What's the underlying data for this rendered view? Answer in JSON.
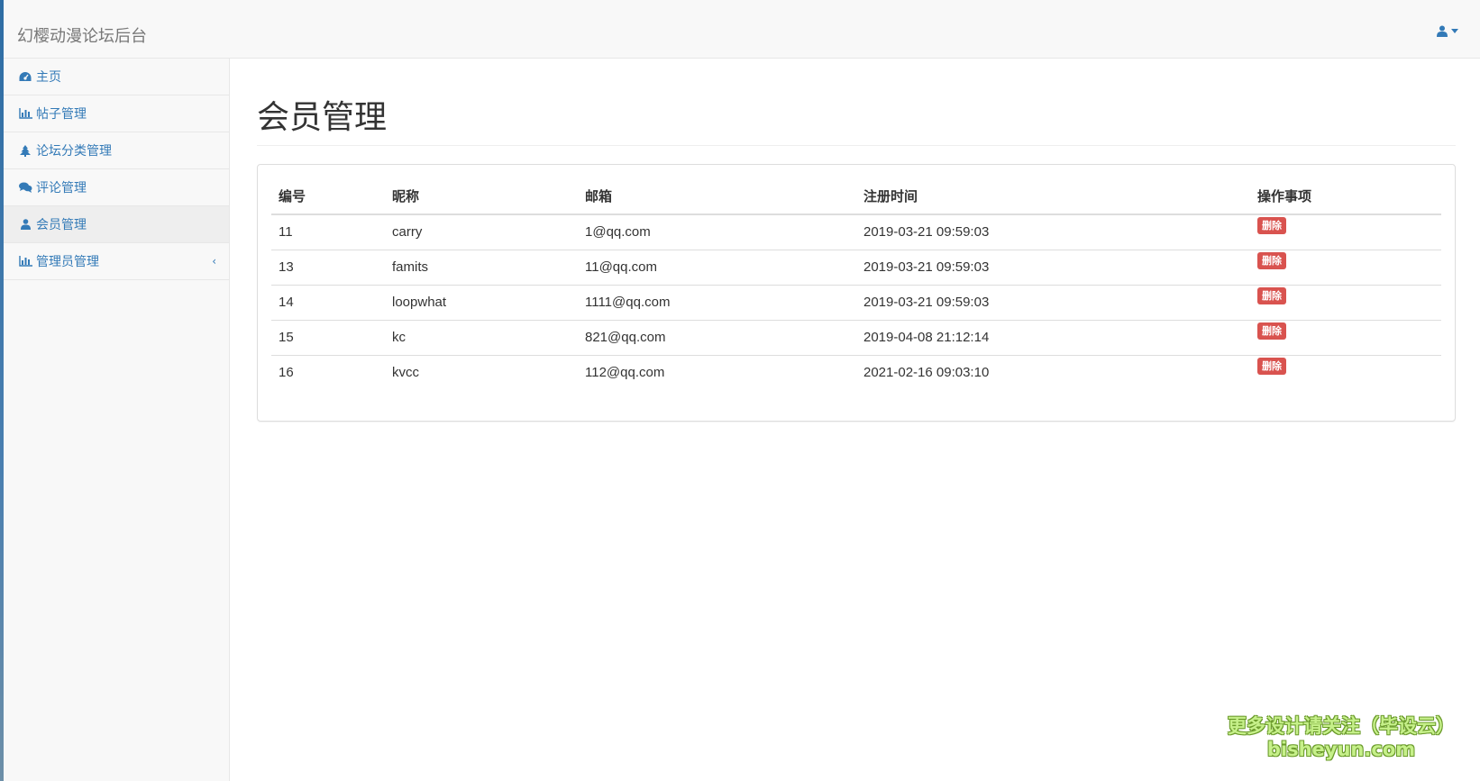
{
  "navbar": {
    "brand": "幻樱动漫论坛后台",
    "user_icon": "user-icon",
    "caret_icon": "caret-down-icon"
  },
  "sidebar": {
    "items": [
      {
        "label": "主页",
        "icon": "dashboard-icon"
      },
      {
        "label": "帖子管理",
        "icon": "bar-chart-icon"
      },
      {
        "label": "论坛分类管理",
        "icon": "tree-icon"
      },
      {
        "label": "评论管理",
        "icon": "comments-icon"
      },
      {
        "label": "会员管理",
        "icon": "user-icon"
      },
      {
        "label": "管理员管理",
        "icon": "bar-chart-icon",
        "arrow": "‹"
      }
    ]
  },
  "main": {
    "title": "会员管理",
    "table": {
      "headers": [
        "编号",
        "昵称",
        "邮箱",
        "注册时间",
        "操作事项"
      ],
      "rows": [
        {
          "id": "11",
          "nickname": "carry",
          "email": "1@qq.com",
          "registered": "2019-03-21 09:59:03",
          "action": "删除"
        },
        {
          "id": "13",
          "nickname": "famits",
          "email": "11@qq.com",
          "registered": "2019-03-21 09:59:03",
          "action": "删除"
        },
        {
          "id": "14",
          "nickname": "loopwhat",
          "email": "1111@qq.com",
          "registered": "2019-03-21 09:59:03",
          "action": "删除"
        },
        {
          "id": "15",
          "nickname": "kc",
          "email": "821@qq.com",
          "registered": "2019-04-08 21:12:14",
          "action": "删除"
        },
        {
          "id": "16",
          "nickname": "kvcc",
          "email": "112@qq.com",
          "registered": "2021-02-16 09:03:10",
          "action": "删除"
        }
      ]
    }
  },
  "watermark": {
    "line1": "更多设计请关注（毕设云）",
    "line2": "bisheyun.com"
  },
  "colors": {
    "link": "#337ab7",
    "danger": "#d9534f",
    "navbar_bg": "#f8f8f8"
  }
}
